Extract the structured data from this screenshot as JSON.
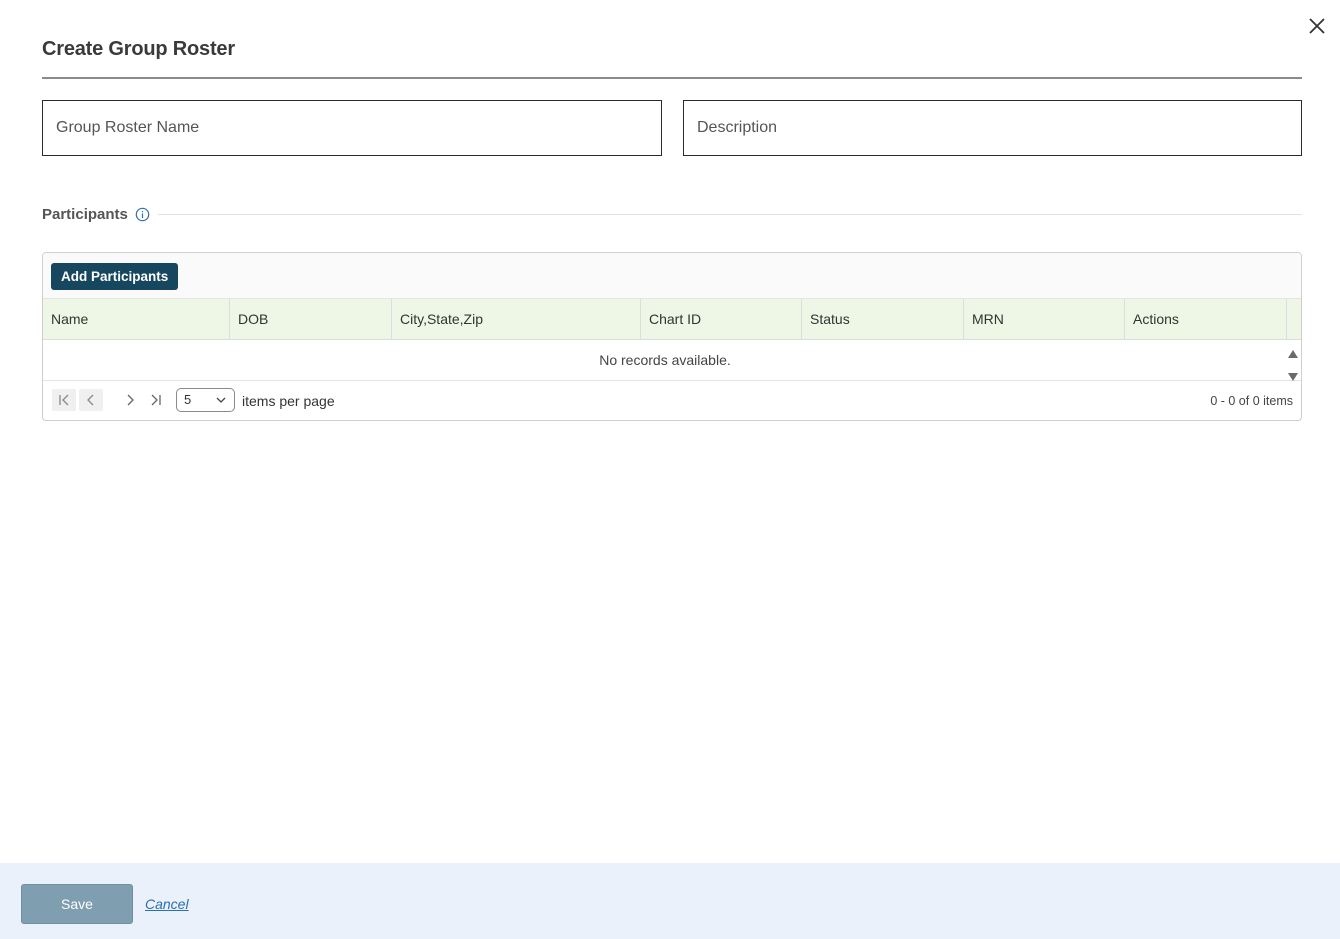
{
  "dialog": {
    "title": "Create Group Roster",
    "close_icon": "close-icon"
  },
  "form": {
    "name_placeholder": "Group Roster Name",
    "name_value": "",
    "description_placeholder": "Description",
    "description_value": ""
  },
  "participants": {
    "section_label": "Participants",
    "info_icon": "info-icon",
    "add_button_label": "Add Participants",
    "columns": [
      "Name",
      "DOB",
      "City,State,Zip",
      "Chart ID",
      "Status",
      "MRN",
      "Actions"
    ],
    "empty_text": "No records available.",
    "pager": {
      "page_size": "5",
      "items_per_page_label": "items per page",
      "info": "0 - 0 of 0 items"
    }
  },
  "footer": {
    "save_label": "Save",
    "cancel_label": "Cancel"
  },
  "colors": {
    "accent_button": "#17475f",
    "header_row": "#eef7e5",
    "footer_bg": "#eaf1fa",
    "save_disabled": "#7f9eaf",
    "link": "#2a6fb0"
  }
}
